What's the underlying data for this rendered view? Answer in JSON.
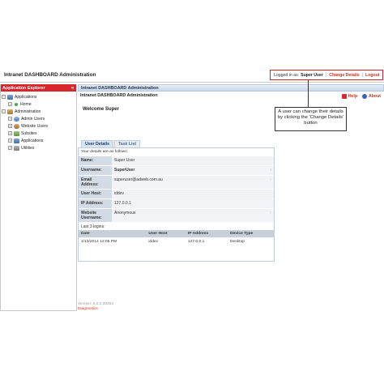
{
  "app": {
    "title": "Intranet DASHBOARD Administration"
  },
  "login": {
    "label": "Logged in as:",
    "user": "Super User",
    "change_details": "Change Details",
    "logout": "Logout"
  },
  "sidebar": {
    "header": "Application Explorer",
    "collapse_glyph": "«",
    "items": [
      {
        "label": "Applications",
        "expander": "−",
        "icon": "applications-icon"
      },
      {
        "label": "Home",
        "expander": "+",
        "icon": "home-icon"
      },
      {
        "label": "Administration",
        "expander": "−",
        "icon": "administration-icon"
      },
      {
        "label": "Admin Users",
        "expander": "+",
        "icon": "admin-users-icon"
      },
      {
        "label": "Website Users",
        "expander": "+",
        "icon": "website-users-icon"
      },
      {
        "label": "Subsites",
        "expander": "+",
        "icon": "subsites-icon"
      },
      {
        "label": "Applications",
        "expander": "+",
        "icon": "applications-icon"
      },
      {
        "label": "Utilities",
        "expander": "+",
        "icon": "utilities-icon"
      }
    ]
  },
  "main": {
    "header": "Intranet DASHBOARD Administration",
    "subtitle": "Intranet DASHBOARD Administration",
    "help": "Help",
    "about": "About",
    "welcome": "Welcome Super",
    "tabs": [
      {
        "label": "User Details"
      },
      {
        "label": "Task List"
      }
    ],
    "details_intro": "Your details are as follows:",
    "details": [
      {
        "key": "Name:",
        "value": "Super User"
      },
      {
        "key": "Username:",
        "value": "SuperUser"
      },
      {
        "key": "Email Address:",
        "value": "superuser@adweb.com.au"
      },
      {
        "key": "User Host:",
        "value": "iddev"
      },
      {
        "key": "IP Address:",
        "value": "127.0.0.1"
      },
      {
        "key": "Website Username:",
        "value": "Anonymous"
      }
    ],
    "logins_label": "Last 3 logins:",
    "logins_table": {
      "headers": [
        "Date",
        "User Host",
        "IP Address",
        "Device Type"
      ],
      "rows": [
        [
          "1/13/2014 12:05 PM",
          "iddev",
          "127.0.0.1",
          "Desktop"
        ]
      ]
    },
    "version": "Version: 6.0.0.39453",
    "diagnostics": "Diagnostics"
  },
  "annotation": {
    "text": "A user can change their details by clicking the 'Change Details' button"
  },
  "colors": {
    "accent_red": "#d7262c",
    "link_red": "#c8351f",
    "panel_blue": "#c9d8ea"
  }
}
